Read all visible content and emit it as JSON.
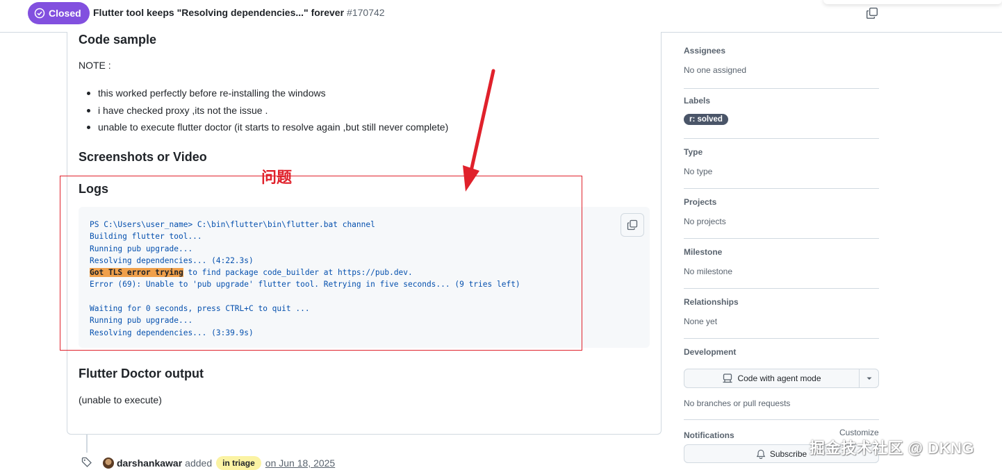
{
  "header": {
    "state": "Closed",
    "title": "Flutter tool keeps \"Resolving dependencies...\" forever",
    "number": "#170742"
  },
  "body": {
    "code_sample_heading": "Code sample",
    "note": "NOTE :",
    "bullets": [
      "this worked perfectly before re-installing the windows",
      "i have checked proxy ,its not the issue .",
      "unable to execute flutter doctor (it starts to resolve again ,but still never complete)"
    ],
    "screenshots_heading": "Screenshots or Video",
    "logs_heading": "Logs",
    "log_lines": [
      "PS C:\\Users\\user_name> C:\\bin\\flutter\\bin\\flutter.bat channel",
      "Building flutter tool...",
      "Running pub upgrade...",
      "Resolving dependencies... (4:22.3s)"
    ],
    "log_highlight": "Got TLS error trying",
    "log_highlight_rest": " to find package code_builder at https://pub.dev.",
    "log_lines_2": [
      "Error (69): Unable to 'pub upgrade' flutter tool. Retrying in five seconds... (9 tries left)",
      "",
      "Waiting for 0 seconds, press CTRL+C to quit ...",
      "Running pub upgrade...",
      "Resolving dependencies... (3:39.9s)"
    ],
    "doctor_heading": "Flutter Doctor output",
    "doctor_text": "(unable to execute)"
  },
  "annotation": {
    "label": "问题",
    "color": "#e0212b"
  },
  "timeline": {
    "actor": "darshankawar",
    "action": "added",
    "label": "in triage",
    "date": "on Jun 18, 2025"
  },
  "sidebar": {
    "assignees": {
      "heading": "Assignees",
      "value": "No one assigned"
    },
    "labels": {
      "heading": "Labels",
      "value": "r: solved"
    },
    "type": {
      "heading": "Type",
      "value": "No type"
    },
    "projects": {
      "heading": "Projects",
      "value": "No projects"
    },
    "milestone": {
      "heading": "Milestone",
      "value": "No milestone"
    },
    "relationships": {
      "heading": "Relationships",
      "value": "None yet"
    },
    "development": {
      "heading": "Development",
      "button": "Code with agent mode",
      "value": "No branches or pull requests"
    },
    "notifications": {
      "heading": "Notifications",
      "customize": "Customize",
      "subscribe": "Subscribe"
    }
  },
  "watermark": "掘金技术社区 @ DKNG",
  "colors": {
    "closed": "#8250df",
    "code_text": "#0550ae",
    "highlight": "#f0a04b",
    "triage": "#fbf3a3",
    "label_pill": "#4a5568"
  }
}
